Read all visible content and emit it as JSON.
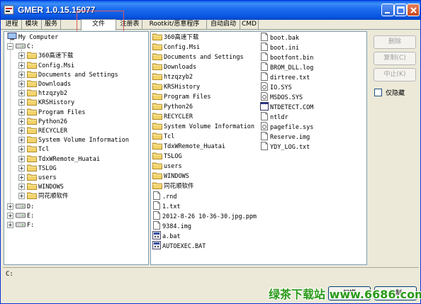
{
  "window": {
    "title": "GMER 1.0.15.15077"
  },
  "tabs": [
    "进程",
    "模块",
    "服务",
    "文件",
    "注册表",
    "Rootkit/恶意程序",
    "自动启动",
    "CMD"
  ],
  "tree": {
    "root": "My Computer",
    "drive_c": "C:",
    "c_children": [
      "360高速下载",
      "Config.Msi",
      "Documents and Settings",
      "Downloads",
      "htzqzyb2",
      "KRSHistory",
      "Program Files",
      "Python26",
      "RECYCLER",
      "System Volume Information",
      "Tcl",
      "TdxWRemote_Huatai",
      "TSLOG",
      "users",
      "WINDOWS",
      "同花顺软件"
    ],
    "other_drives": [
      "D:",
      "E:",
      "F:"
    ]
  },
  "files": {
    "col1_folders": [
      "360高速下载",
      "Config.Msi",
      "Documents and Settings",
      "Downloads",
      "htzqzyb2",
      "KRSHistory",
      "Program Files",
      "Python26",
      "RECYCLER",
      "System Volume Information",
      "Tcl",
      "TdxWRemote_Huatai",
      "TSLOG",
      "users",
      "WINDOWS",
      "同花顺软件"
    ],
    "col1_files": [
      ".rnd",
      "1.txt",
      "2012-8-26 10-36-30.jpg.ppm",
      "9384.img",
      "a.bat",
      "AUTOEXEC.BAT"
    ],
    "col2_files": [
      "boot.bak",
      "boot.ini",
      "bootfont.bin",
      "BROM_DLL.log",
      "dirtree.txt",
      "IO.SYS",
      "MSDOS.SYS",
      "NTDETECT.COM",
      "ntldr",
      "pagefile.sys",
      "Reserve.img",
      "YDY_LOG.txt"
    ]
  },
  "buttons": {
    "delete": "删除",
    "copy": "复制(C)",
    "stop": "中止(K)"
  },
  "hidden_only": {
    "label": "仅隐藏"
  },
  "path": {
    "value": "C:"
  },
  "status_buttons": {
    "scan": "扫描",
    "copy": "复制"
  },
  "watermark": "绿茶下载站 www.6686.com"
}
